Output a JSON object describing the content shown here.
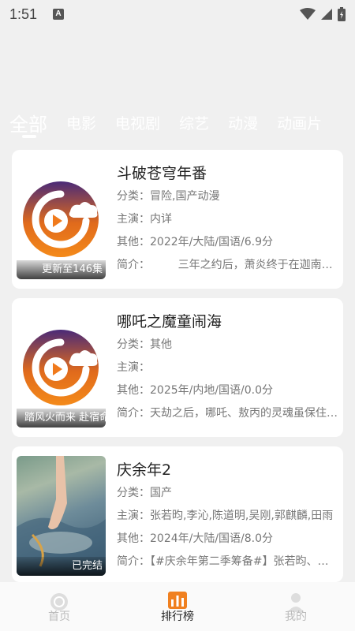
{
  "status": {
    "time": "1:51",
    "notif_icon": "A"
  },
  "tabs": [
    {
      "label": "全部"
    },
    {
      "label": "电影"
    },
    {
      "label": "电视剧"
    },
    {
      "label": "综艺"
    },
    {
      "label": "动漫"
    },
    {
      "label": "动画片"
    }
  ],
  "field_labels": {
    "category": "分类：",
    "cast": "主演：",
    "other": "其他：",
    "intro": "简介："
  },
  "items": [
    {
      "title": "斗破苍穹年番",
      "category": "冒险,国产动漫",
      "cast": "内详",
      "other": "2022年/大陆/国语/6.9分",
      "intro": "        三年之约后，萧炎终于在迦南学院见到了思念已久的萧薰儿",
      "badge": "更新至146集"
    },
    {
      "title": "哪吒之魔童闹海",
      "category": "其他",
      "cast": "",
      "other": "2025年/内地/国语/0.0分",
      "intro": "天劫之后，哪吒、敖丙的灵魂虽保住了，但肉身很快会魂飞魄散",
      "badge": "踏风火而来 赴宿命之约"
    },
    {
      "title": "庆余年2",
      "category": "国产",
      "cast": "张若昀,李沁,陈道明,吴刚,郭麒麟,田雨",
      "other": "2024年/大陆/国语/8.0分",
      "intro": "【#庆余年第二季筹备#】张若昀、李沁",
      "badge": "已完结"
    }
  ],
  "bottom_nav": [
    {
      "label": "首页",
      "icon": "home-icon"
    },
    {
      "label": "排行榜",
      "icon": "ranking-icon"
    },
    {
      "label": "我的",
      "icon": "profile-icon"
    }
  ],
  "colors": {
    "accent_orange": "#f0801c",
    "accent_purple": "#4a2a78",
    "background": "#f0f0f0"
  }
}
